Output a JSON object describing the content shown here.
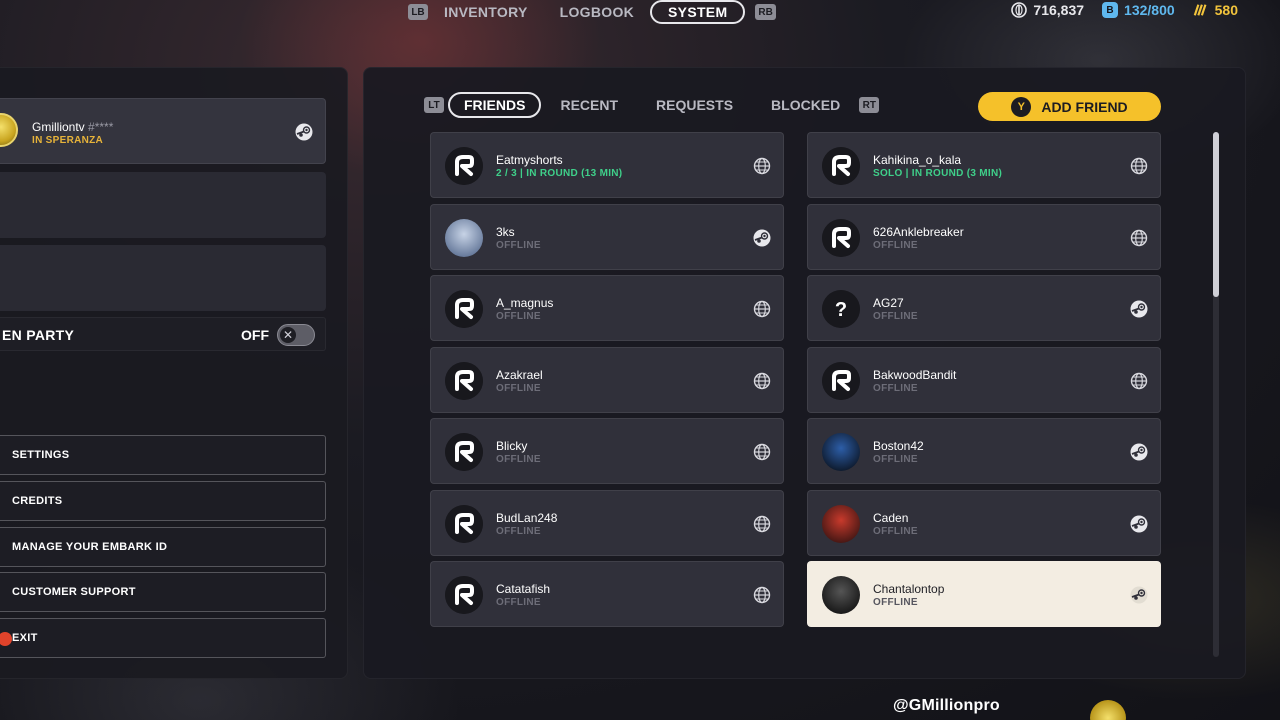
{
  "topnav": {
    "lb": "LB",
    "rb": "RB",
    "tabs": [
      {
        "label": "INVENTORY"
      },
      {
        "label": "LOGBOOK"
      },
      {
        "label": "SYSTEM",
        "active": true
      }
    ]
  },
  "currencies": [
    {
      "icon": "coin-icon",
      "value": "716,837",
      "color": "#ffffff"
    },
    {
      "icon": "backpack-capacity-icon",
      "value": "132/800",
      "color": "#5fb8ee"
    },
    {
      "icon": "cred-icon",
      "value": "580",
      "color": "#f2c43c"
    }
  ],
  "profile": {
    "name": "Gmilliontv",
    "tag": "#****",
    "status": "IN SPERANZA",
    "platform": "steam-icon"
  },
  "party": {
    "label": "EN PARTY",
    "state": "OFF"
  },
  "menu": [
    {
      "label": "SETTINGS"
    },
    {
      "label": "CREDITS"
    },
    {
      "label": "MANAGE YOUR EMBARK ID"
    },
    {
      "label": "CUSTOMER SUPPORT"
    },
    {
      "label": "EXIT"
    }
  ],
  "friend_tabs": {
    "lt": "LT",
    "rt": "RT",
    "tabs": [
      {
        "label": "FRIENDS",
        "active": true
      },
      {
        "label": "RECENT"
      },
      {
        "label": "REQUESTS"
      },
      {
        "label": "BLOCKED"
      }
    ],
    "add_friend": {
      "key": "Y",
      "label": "ADD FRIEND"
    }
  },
  "friends": [
    {
      "name": "Eatmyshorts",
      "status": "2 / 3 | IN ROUND (13 MIN)",
      "online": true,
      "avatar": "embark-logo",
      "platform": "globe-icon"
    },
    {
      "name": "Kahikina_o_kala",
      "status": "SOLO | IN ROUND (3 MIN)",
      "online": true,
      "avatar": "embark-logo",
      "platform": "globe-icon"
    },
    {
      "name": "3ks",
      "status": "OFFLINE",
      "avatar": "custom-avatar",
      "platform": "steam-icon"
    },
    {
      "name": "626Anklebreaker",
      "status": "OFFLINE",
      "avatar": "embark-logo",
      "platform": "globe-icon"
    },
    {
      "name": "A_magnus",
      "status": "OFFLINE",
      "avatar": "embark-logo",
      "platform": "globe-icon"
    },
    {
      "name": "AG27",
      "status": "OFFLINE",
      "avatar": "question-mark",
      "platform": "steam-icon"
    },
    {
      "name": "Azakrael",
      "status": "OFFLINE",
      "avatar": "embark-logo",
      "platform": "globe-icon"
    },
    {
      "name": "BakwoodBandit",
      "status": "OFFLINE",
      "avatar": "embark-logo",
      "platform": "globe-icon"
    },
    {
      "name": "Blicky",
      "status": "OFFLINE",
      "avatar": "embark-logo",
      "platform": "globe-icon"
    },
    {
      "name": "Boston42",
      "status": "OFFLINE",
      "avatar": "custom-avatar",
      "platform": "steam-icon"
    },
    {
      "name": "BudLan248",
      "status": "OFFLINE",
      "avatar": "embark-logo",
      "platform": "globe-icon"
    },
    {
      "name": "Caden",
      "status": "OFFLINE",
      "avatar": "custom-avatar",
      "platform": "steam-icon"
    },
    {
      "name": "Catatafish",
      "status": "OFFLINE",
      "avatar": "embark-logo",
      "platform": "globe-icon"
    },
    {
      "name": "Chantalontop",
      "status": "OFFLINE",
      "avatar": "custom-avatar",
      "platform": "steam-icon",
      "highlight": true
    }
  ],
  "watermark": "@GMillionpro"
}
